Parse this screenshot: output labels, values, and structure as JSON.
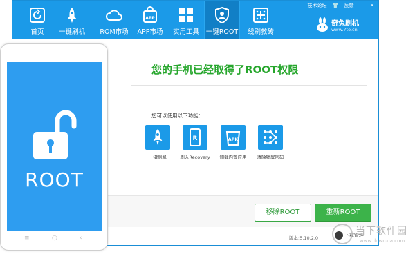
{
  "nav": {
    "items": [
      {
        "label": "首页",
        "icon": "refresh-square-icon"
      },
      {
        "label": "一键刷机",
        "icon": "rocket-icon"
      },
      {
        "label": "ROM市场",
        "icon": "cloud-icon"
      },
      {
        "label": "APP市场",
        "icon": "app-bag-icon"
      },
      {
        "label": "实用工具",
        "icon": "grid-icon"
      },
      {
        "label": "一键ROOT",
        "icon": "shield-icon",
        "active": true
      },
      {
        "label": "线刷救砖",
        "icon": "dots-grid-icon"
      }
    ]
  },
  "toplinks": {
    "forum": "技术论坛",
    "shirt": "👕",
    "feedback": "反馈",
    "minimize": "—",
    "close": "✕"
  },
  "brand": {
    "name": "奇兔刷机",
    "url": "www.7to.cn"
  },
  "main": {
    "headline": "您的手机已经取得了ROOT权限",
    "subtitle": "您可以使用以下功能：",
    "features": [
      {
        "label": "一键刷机",
        "icon": "rocket-icon"
      },
      {
        "label": "刷入Recovery",
        "icon": "recovery-phone-icon",
        "glyph": "R"
      },
      {
        "label": "卸载内置应用",
        "icon": "apk-uninstall-icon",
        "glyph": "APK"
      },
      {
        "label": "清除锁屏密码",
        "icon": "pattern-lock-icon"
      }
    ]
  },
  "buttons": {
    "remove_root": "移除ROOT",
    "re_root": "重新ROOT"
  },
  "status": {
    "version": "版本:5.10.2.0",
    "download_manager": "下载管理"
  },
  "phone": {
    "screen_text": "ROOT",
    "softkeys": [
      "≡",
      "○",
      "‹"
    ]
  },
  "watermark": {
    "name": "当下软件园",
    "url": "www.downxia.com"
  },
  "colors": {
    "topbar": "#1b9ae8",
    "headline": "#26a62c",
    "button_fill": "#3cb34a",
    "phone_screen": "#2e9df0"
  }
}
